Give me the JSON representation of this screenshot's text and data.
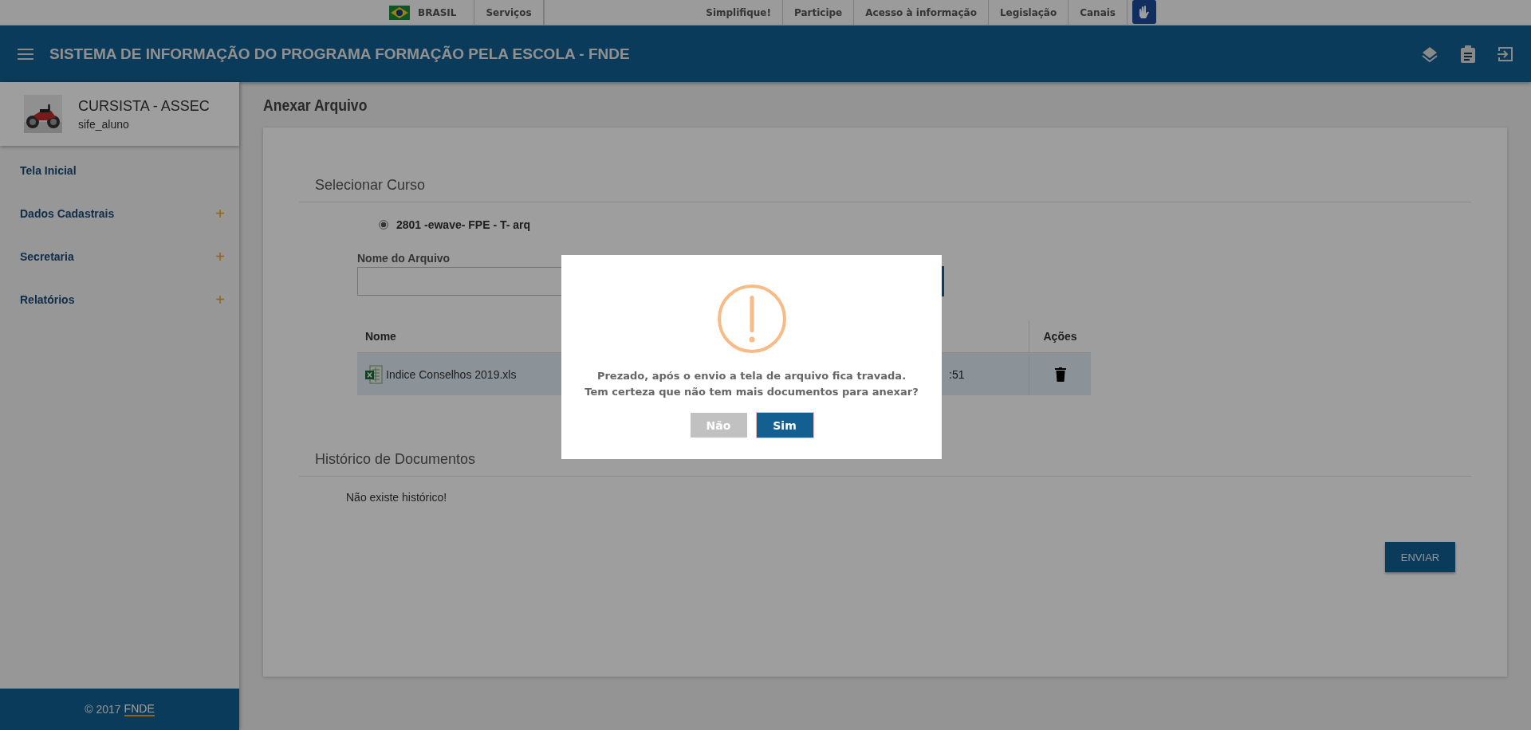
{
  "gov_bar": {
    "country": "BRASIL",
    "left_links": [
      "Serviços"
    ],
    "right_links": [
      "Simplifique!",
      "Participe",
      "Acesso à informação",
      "Legislação",
      "Canais"
    ]
  },
  "header": {
    "title": "SISTEMA DE INFORMAÇÃO DO PROGRAMA FORMAÇÃO PELA ESCOLA - FNDE"
  },
  "sidebar": {
    "user": {
      "name": "CURSISTA - ASSEC",
      "login": "sife_aluno"
    },
    "items": [
      {
        "label": "Tela Inicial"
      },
      {
        "label": "Dados Cadastrais",
        "toggle": "+"
      },
      {
        "label": "Secretaria",
        "toggle": "+"
      },
      {
        "label": "Relatórios",
        "toggle": "+"
      }
    ],
    "footer": {
      "prefix": "© 2017",
      "link": "FNDE"
    }
  },
  "page": {
    "title": "Anexar Arquivo",
    "course_section": {
      "title": "Selecionar Curso",
      "options": [
        {
          "label": "2801 -ewave- FPE - T- arq",
          "selected": true
        }
      ]
    },
    "file_name": {
      "label": "Nome do Arquivo"
    },
    "table": {
      "columns": [
        "Nome",
        "Ações"
      ],
      "rows": [
        {
          "name": "Indice Conselhos 2019.xls",
          "column_2": ":51"
        }
      ]
    },
    "history": {
      "title": "Histórico de Documentos",
      "empty": "Não existe histórico!"
    },
    "submit": "ENVIAR"
  },
  "dialog": {
    "message": "Prezado, após o envio a tela de arquivo fica travada. Tem certeza que não tem mais documentos para anexar?",
    "buttons": [
      {
        "label": "Não",
        "kind": "cancel"
      },
      {
        "label": "Sim",
        "kind": "confirm"
      }
    ]
  }
}
